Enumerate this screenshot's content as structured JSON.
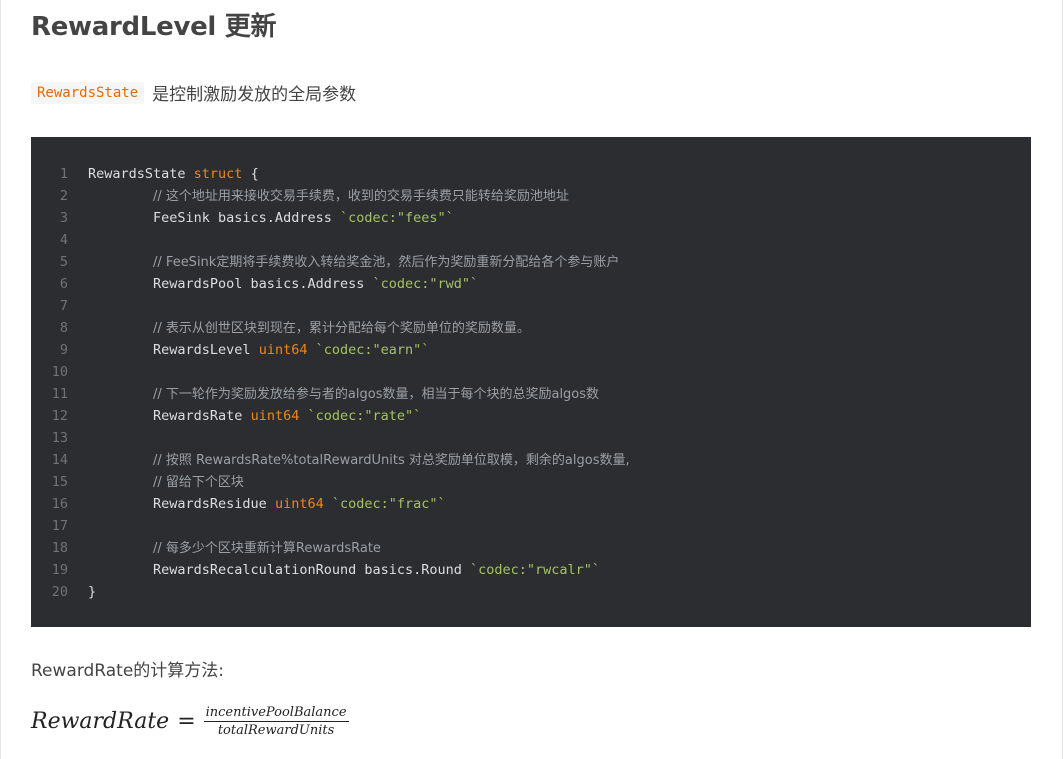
{
  "heading": "RewardLevel 更新",
  "intro": {
    "code": "RewardsState",
    "text": "是控制激励发放的全局参数"
  },
  "code_block": {
    "lines": [
      {
        "n": "1",
        "tokens": [
          {
            "t": "RewardsState ",
            "c": "plain"
          },
          {
            "t": "struct",
            "c": "kw"
          },
          {
            "t": " {",
            "c": "plain"
          }
        ]
      },
      {
        "n": "2",
        "tokens": [
          {
            "t": "        ",
            "c": "plain"
          },
          {
            "t": "// 这个地址用来接收交易手续费，收到的交易手续费只能转给奖励池地址",
            "c": "comment"
          }
        ]
      },
      {
        "n": "3",
        "tokens": [
          {
            "t": "        FeeSink basics.Address ",
            "c": "plain"
          },
          {
            "t": "`codec:\"fees\"`",
            "c": "str"
          }
        ]
      },
      {
        "n": "4",
        "tokens": []
      },
      {
        "n": "5",
        "tokens": [
          {
            "t": "        ",
            "c": "plain"
          },
          {
            "t": "// FeeSink定期将手续费收入转给奖金池，然后作为奖励重新分配给各个参与账户",
            "c": "comment"
          }
        ]
      },
      {
        "n": "6",
        "tokens": [
          {
            "t": "        RewardsPool basics.Address ",
            "c": "plain"
          },
          {
            "t": "`codec:\"rwd\"`",
            "c": "str"
          }
        ]
      },
      {
        "n": "7",
        "tokens": []
      },
      {
        "n": "8",
        "tokens": [
          {
            "t": "        ",
            "c": "plain"
          },
          {
            "t": "// 表示从创世区块到现在，累计分配给每个奖励单位的奖励数量。",
            "c": "comment"
          }
        ]
      },
      {
        "n": "9",
        "tokens": [
          {
            "t": "        RewardsLevel ",
            "c": "plain"
          },
          {
            "t": "uint64",
            "c": "kw"
          },
          {
            "t": " ",
            "c": "plain"
          },
          {
            "t": "`codec:\"earn\"`",
            "c": "str"
          }
        ]
      },
      {
        "n": "10",
        "tokens": []
      },
      {
        "n": "11",
        "tokens": [
          {
            "t": "        ",
            "c": "plain"
          },
          {
            "t": "// 下一轮作为奖励发放给参与者的algos数量，相当于每个块的总奖励algos数",
            "c": "comment"
          }
        ]
      },
      {
        "n": "12",
        "tokens": [
          {
            "t": "        RewardsRate ",
            "c": "plain"
          },
          {
            "t": "uint64",
            "c": "kw"
          },
          {
            "t": " ",
            "c": "plain"
          },
          {
            "t": "`codec:\"rate\"`",
            "c": "str"
          }
        ]
      },
      {
        "n": "13",
        "tokens": []
      },
      {
        "n": "14",
        "tokens": [
          {
            "t": "        ",
            "c": "plain"
          },
          {
            "t": "// 按照 RewardsRate%totalRewardUnits 对总奖励单位取模，剩余的algos数量,",
            "c": "comment"
          }
        ]
      },
      {
        "n": "15",
        "tokens": [
          {
            "t": "        ",
            "c": "plain"
          },
          {
            "t": "// 留给下个区块",
            "c": "comment"
          }
        ]
      },
      {
        "n": "16",
        "tokens": [
          {
            "t": "        RewardsResidue ",
            "c": "plain"
          },
          {
            "t": "uint64",
            "c": "kw"
          },
          {
            "t": " ",
            "c": "plain"
          },
          {
            "t": "`codec:\"frac\"`",
            "c": "str"
          }
        ]
      },
      {
        "n": "17",
        "tokens": []
      },
      {
        "n": "18",
        "tokens": [
          {
            "t": "        ",
            "c": "plain"
          },
          {
            "t": "// 每多少个区块重新计算RewardsRate",
            "c": "comment"
          }
        ]
      },
      {
        "n": "19",
        "tokens": [
          {
            "t": "        RewardsRecalculationRound basics.Round ",
            "c": "plain"
          },
          {
            "t": "`codec:\"rwcalr\"`",
            "c": "str"
          }
        ]
      },
      {
        "n": "20",
        "tokens": [
          {
            "t": "}",
            "c": "plain"
          }
        ]
      }
    ]
  },
  "paragraph": "RewardRate的计算方法:",
  "formula": {
    "lhs": "RewardRate",
    "eq": "=",
    "numerator": "incentivePoolBalance",
    "denominator": "totalRewardUnits"
  }
}
